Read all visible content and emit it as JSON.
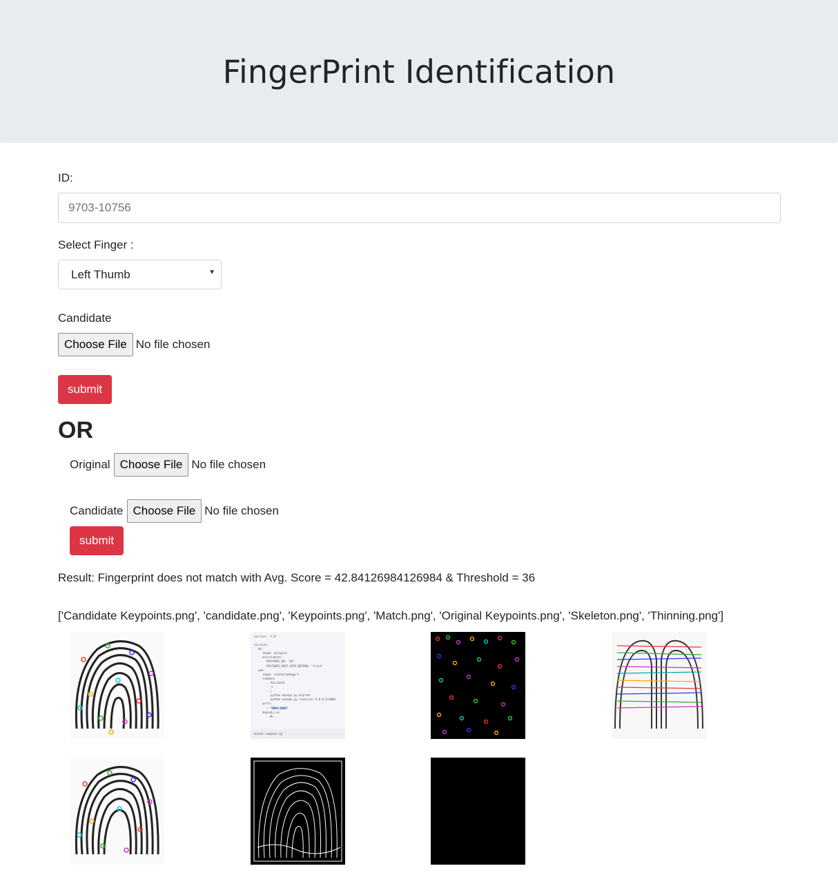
{
  "header": {
    "title": "FingerPrint Identification"
  },
  "form": {
    "id_label": "ID:",
    "id_placeholder": "9703-10756",
    "finger_label": "Select Finger :",
    "finger_selected": "Left Thumb",
    "candidate_label": "Candidate",
    "choose_file": "Choose File",
    "no_file": "No file chosen",
    "submit_label": "submit"
  },
  "or_section": {
    "or_label": "OR",
    "original_label": "Original",
    "candidate_label": "Candidate",
    "choose_file": "Choose File",
    "no_file": "No file chosen",
    "submit_label": "submit"
  },
  "result": {
    "text": "Result: Fingerprint does not match with Avg. Score = 42.84126984126984 & Threshold = 36",
    "files_list": "['Candidate Keypoints.png', 'candidate.png', 'Keypoints.png', 'Match.png', 'Original Keypoints.png', 'Skeleton.png', 'Thinning.png']"
  },
  "images": [
    {
      "name": "candidate-keypoints-image"
    },
    {
      "name": "candidate-image"
    },
    {
      "name": "keypoints-image"
    },
    {
      "name": "match-image"
    },
    {
      "name": "original-keypoints-image"
    },
    {
      "name": "skeleton-image"
    },
    {
      "name": "thinning-image"
    }
  ],
  "candidate_image_text": {
    "lines": [
      "version: '3.8'",
      "services:",
      "db:",
      "image: postgres",
      "environment:",
      "POSTGRES_DB: \"db\"",
      "POSTGRES_HOST_AUTH_METHOD: \"trust\"",
      "web:",
      "image: studra/webapp:1",
      "command:",
      "- /bin/bash",
      "- -c",
      "- |",
      "python manage.py migrate",
      "python manage.py runserver 0.0.0.0:8000",
      "ports:",
      "- \"8000:8000\"",
      "depends_on:",
      "- db"
    ],
    "footer": "docker-compose up"
  }
}
